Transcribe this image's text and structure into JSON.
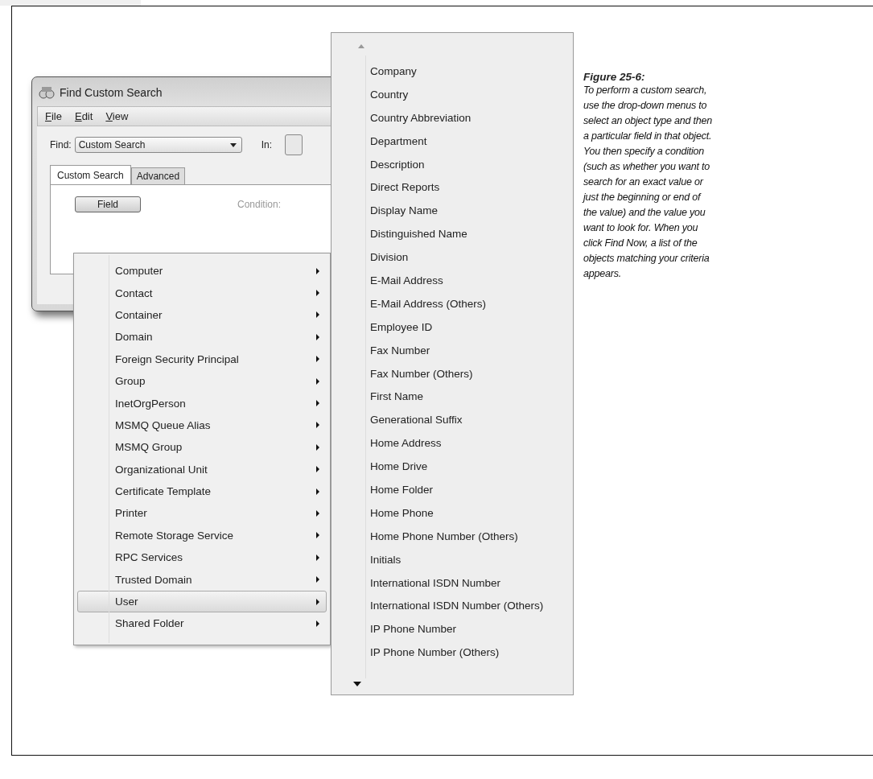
{
  "dialog": {
    "title": "Find Custom Search",
    "menu_bar": [
      {
        "label": "File",
        "mnemonic": true
      },
      {
        "label": "Edit",
        "mnemonic": true
      },
      {
        "label": "View",
        "mnemonic": true
      }
    ],
    "find_label": "Find:",
    "find_value": "Custom Search",
    "in_label": "In:",
    "tabs": [
      {
        "label": "Custom Search",
        "selected": true
      },
      {
        "label": "Advanced",
        "selected": false
      }
    ],
    "field_button": "Field",
    "condition_label": "Condition:"
  },
  "object_menu": [
    {
      "label": "Computer",
      "selected": false
    },
    {
      "label": "Contact",
      "selected": false
    },
    {
      "label": "Container",
      "selected": false
    },
    {
      "label": "Domain",
      "selected": false
    },
    {
      "label": "Foreign Security Principal",
      "selected": false
    },
    {
      "label": "Group",
      "selected": false
    },
    {
      "label": "InetOrgPerson",
      "selected": false
    },
    {
      "label": "MSMQ Queue Alias",
      "selected": false
    },
    {
      "label": "MSMQ Group",
      "selected": false
    },
    {
      "label": "Organizational Unit",
      "selected": false
    },
    {
      "label": "Certificate Template",
      "selected": false
    },
    {
      "label": "Printer",
      "selected": false
    },
    {
      "label": "Remote Storage Service",
      "selected": false
    },
    {
      "label": "RPC Services",
      "selected": false
    },
    {
      "label": "Trusted Domain",
      "selected": false
    },
    {
      "label": "User",
      "selected": true
    },
    {
      "label": "Shared Folder",
      "selected": false
    }
  ],
  "field_menu": [
    "Company",
    "Country",
    "Country Abbreviation",
    "Department",
    "Description",
    "Direct Reports",
    "Display Name",
    "Distinguished Name",
    "Division",
    "E-Mail Address",
    "E-Mail Address (Others)",
    "Employee ID",
    "Fax Number",
    "Fax Number (Others)",
    "First Name",
    "Generational Suffix",
    "Home Address",
    "Home Drive",
    "Home Folder",
    "Home Phone",
    "Home Phone Number (Others)",
    "Initials",
    "International ISDN Number",
    "International ISDN Number (Others)",
    "IP Phone Number",
    "IP Phone Number (Others)"
  ],
  "caption": {
    "label": "Figure 25-6:",
    "text": "To perform a custom search, use the drop-down menus to select an object type and then a particular field in that object. You then specify a condition (such as whether you want to search for an exact value or just the beginning or end of the value) and the value you want to look for. When you click Find Now, a list of the objects matching your criteria appears."
  }
}
